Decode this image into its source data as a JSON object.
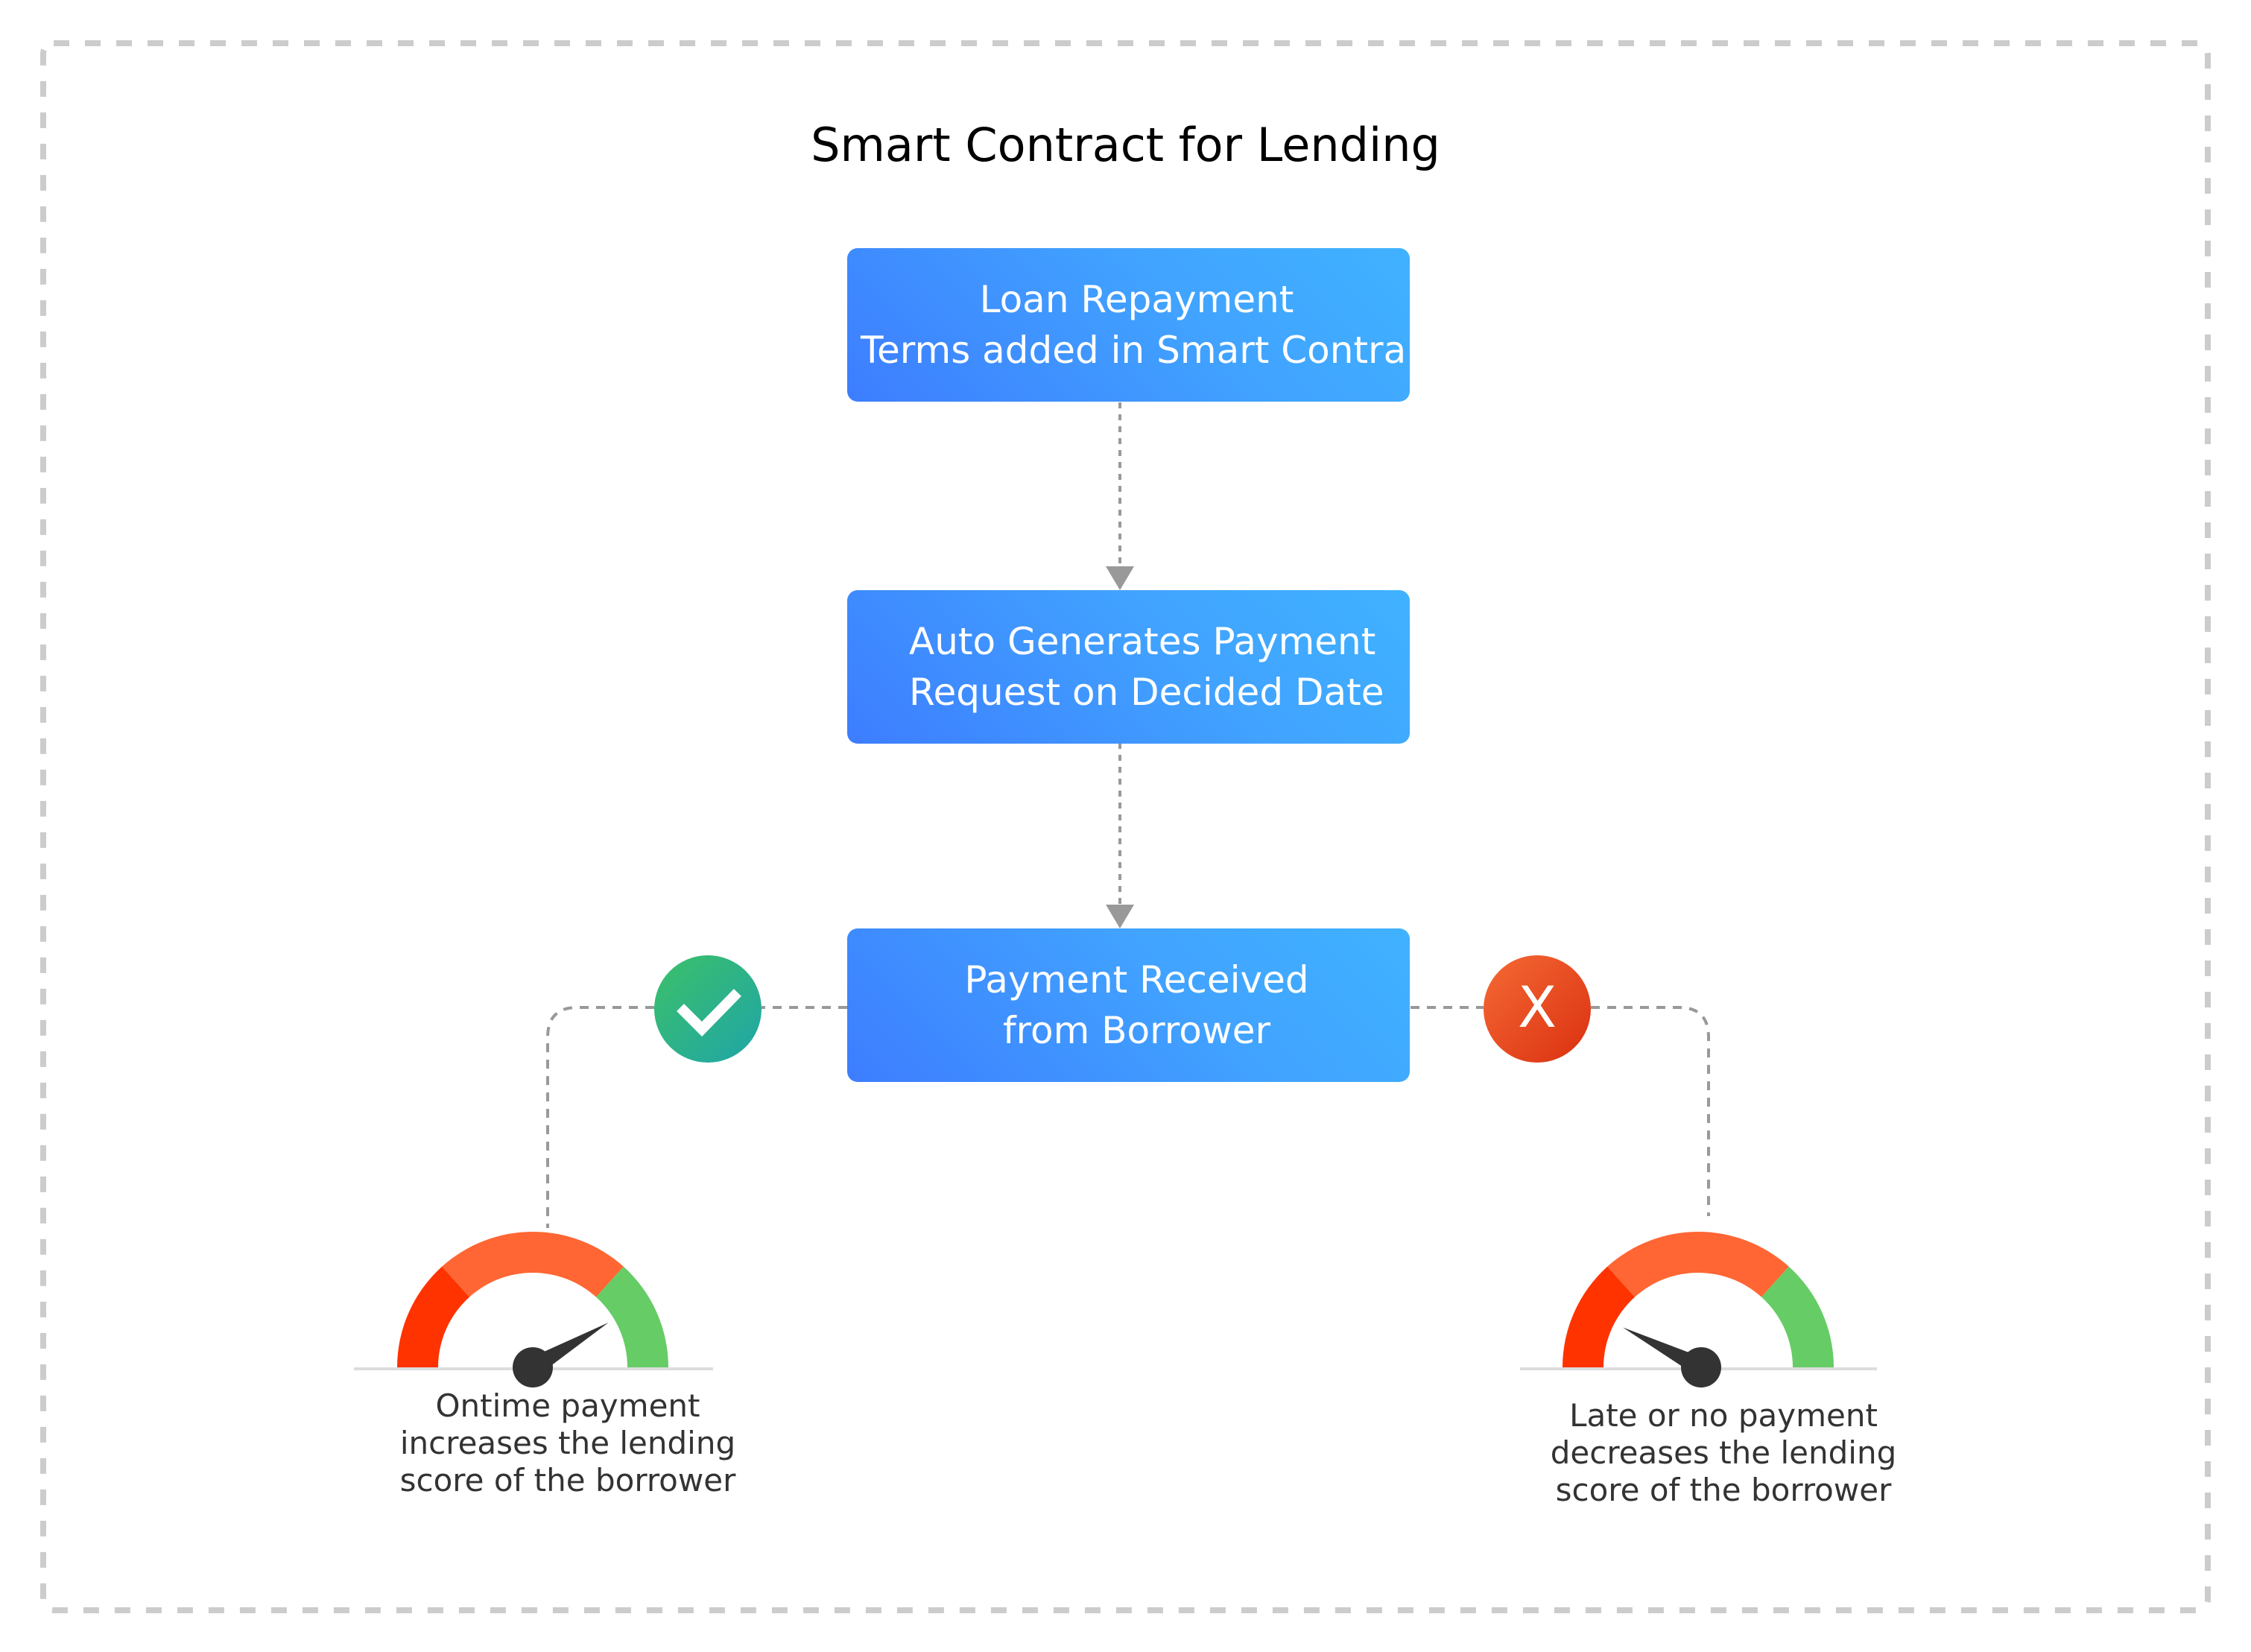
{
  "title": "Smart Contract for Lending",
  "steps": [
    {
      "lines": [
        "Loan Repayment",
        "Terms added in Smart Contra"
      ]
    },
    {
      "lines": [
        "Auto Generates Payment",
        "Request on Decided Date"
      ]
    },
    {
      "lines": [
        "Payment Received",
        "from Borrower"
      ]
    }
  ],
  "outcomes": {
    "success": {
      "icon": "check-icon",
      "caption": [
        "Ontime payment",
        "increases the lending",
        "score of the borrower"
      ],
      "gauge_level": 0.83
    },
    "failure": {
      "icon": "x-icon",
      "icon_glyph": "X",
      "caption": [
        "Late or no payment",
        "decreases the lending",
        "score of the borrower"
      ],
      "gauge_level": 0.15
    }
  },
  "colors": {
    "box_gradient_start": "#3d7dff",
    "box_gradient_end": "#40b2ff",
    "success_start": "#3cc068",
    "success_end": "#1fa5a8",
    "failure_start": "#f56a35",
    "failure_end": "#da3010",
    "gauge_red": "#ff3300",
    "gauge_orange": "#ff6633",
    "gauge_green": "#66cc66",
    "connector": "#999999",
    "frame": "#cccccc",
    "needle": "#333333"
  }
}
